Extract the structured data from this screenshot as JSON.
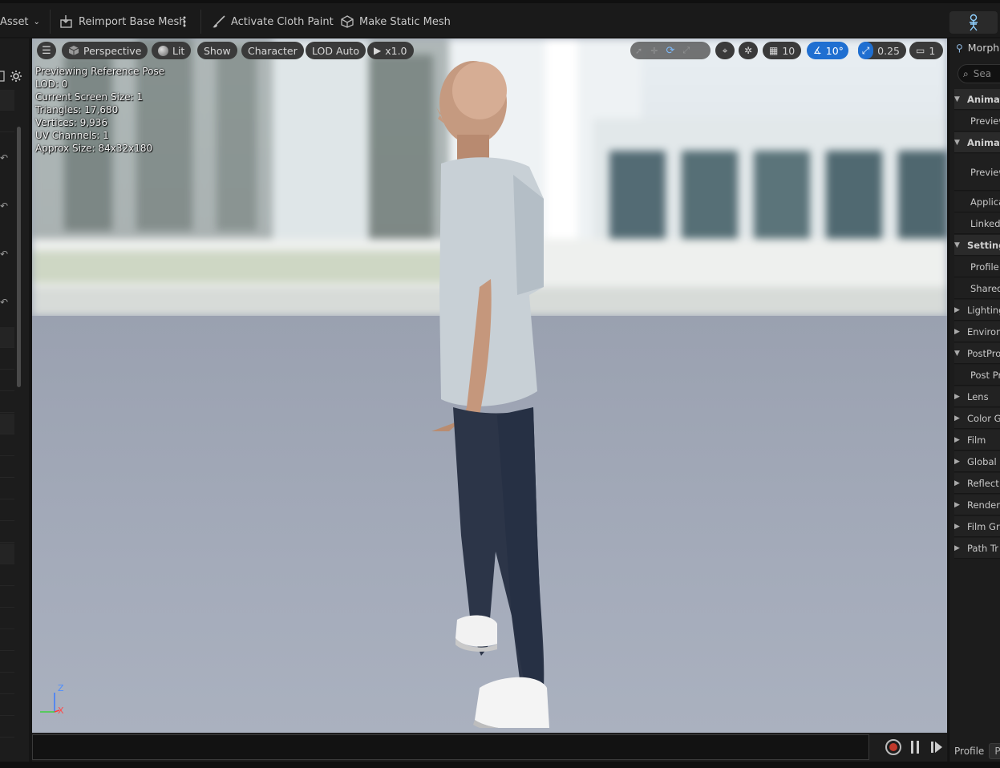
{
  "toolbar": {
    "asset_menu": "Asset",
    "reimport": "Reimport Base Mesh",
    "cloth_paint": "Activate Cloth Paint",
    "static_mesh": "Make Static Mesh"
  },
  "viewport": {
    "perspective": "Perspective",
    "lit": "Lit",
    "show": "Show",
    "character": "Character",
    "lod": "LOD Auto",
    "speed": "x1.0",
    "grid_value": "10",
    "angle_value": "10°",
    "scale_value": "0.25",
    "camera_value": "1",
    "stats": [
      "Previewing Reference Pose",
      "LOD: 0",
      "Current Screen Size: 1",
      "Triangles: 17,680",
      "Vertices: 9,936",
      "UV Channels: 1",
      "Approx Size: 84x32x180"
    ],
    "axis_z": "Z",
    "axis_x": "X"
  },
  "right_panel": {
    "tab_label": "Morph",
    "search_placeholder": "Sea",
    "rows": [
      {
        "label": "Animat",
        "kind": "section",
        "caret": "▼"
      },
      {
        "label": "Preview",
        "kind": "child"
      },
      {
        "label": "Animat",
        "kind": "section",
        "caret": "▼"
      },
      {
        "label": "Preview",
        "kind": "child-tall"
      },
      {
        "label": "Applica",
        "kind": "child"
      },
      {
        "label": "Linked",
        "kind": "child"
      },
      {
        "label": "Setting",
        "kind": "section",
        "caret": "▼"
      },
      {
        "label": "Profile",
        "kind": "child"
      },
      {
        "label": "Shared",
        "kind": "child"
      },
      {
        "label": "Lighting",
        "kind": "sub",
        "caret": "▶"
      },
      {
        "label": "Environ",
        "kind": "sub",
        "caret": "▶"
      },
      {
        "label": "PostPro",
        "kind": "sub",
        "caret": "▼"
      },
      {
        "label": "Post Pr",
        "kind": "child"
      },
      {
        "label": "Lens",
        "kind": "sub",
        "caret": "▶"
      },
      {
        "label": "Color G",
        "kind": "sub",
        "caret": "▶"
      },
      {
        "label": "Film",
        "kind": "sub",
        "caret": "▶"
      },
      {
        "label": "Global I",
        "kind": "sub",
        "caret": "▶"
      },
      {
        "label": "Reflect",
        "kind": "sub",
        "caret": "▶"
      },
      {
        "label": "Render",
        "kind": "sub",
        "caret": "▶"
      },
      {
        "label": "Film Gr",
        "kind": "sub",
        "caret": "▶"
      },
      {
        "label": "Path Tr",
        "kind": "sub",
        "caret": "▶"
      }
    ],
    "bottom_label": "Profile",
    "bottom_field": "Pr"
  },
  "colors": {
    "accent": "#1f6fd1",
    "record": "#c0392b"
  }
}
